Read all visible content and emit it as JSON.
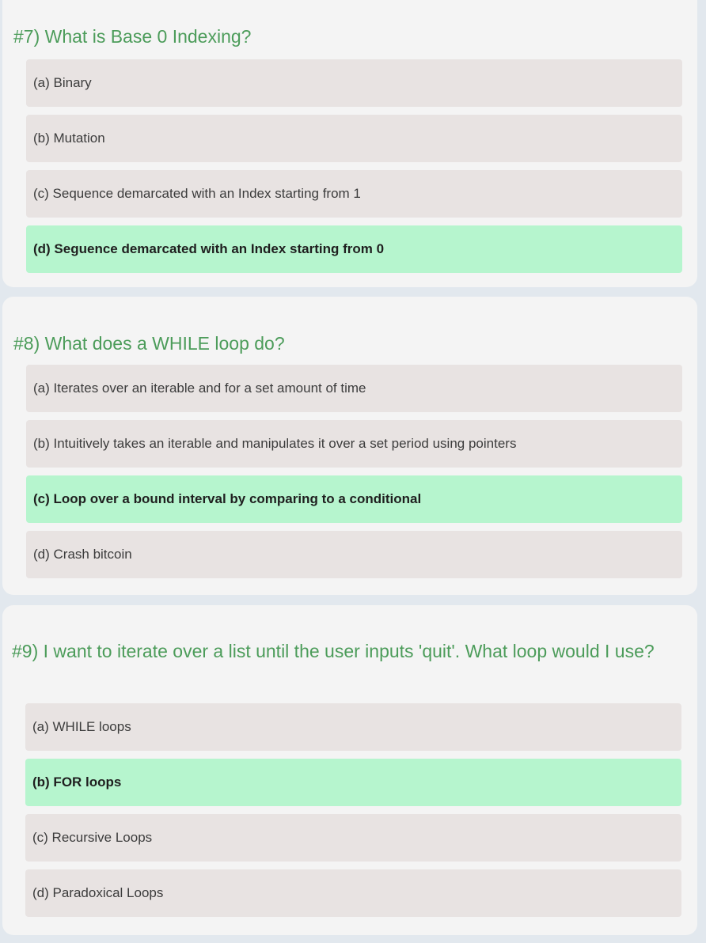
{
  "questions": [
    {
      "number": "#7)",
      "text": "What is Base 0 Indexing?",
      "options": [
        {
          "label": "(a) Binary",
          "correct": false
        },
        {
          "label": "(b) Mutation",
          "correct": false
        },
        {
          "label": "(c) Sequence demarcated with an Index starting from 1",
          "correct": false
        },
        {
          "label": "(d) Seguence demarcated with an Index starting from 0",
          "correct": true
        }
      ]
    },
    {
      "number": "#8)",
      "text": "What does a WHILE loop do?",
      "options": [
        {
          "label": "(a) Iterates over an iterable and for a set amount of time",
          "correct": false
        },
        {
          "label": "(b) Intuitively takes an iterable and manipulates it over a set period using pointers",
          "correct": false
        },
        {
          "label": "(c) Loop over a bound interval by comparing to a conditional",
          "correct": true
        },
        {
          "label": "(d) Crash bitcoin",
          "correct": false
        }
      ]
    },
    {
      "number": "#9)",
      "text": "I want to iterate over a list until the user inputs 'quit'. What loop would I use?",
      "options": [
        {
          "label": "(a) WHILE loops",
          "correct": false
        },
        {
          "label": "(b) FOR loops",
          "correct": true
        },
        {
          "label": "(c) Recursive Loops",
          "correct": false
        },
        {
          "label": "(d) Paradoxical Loops",
          "correct": false
        }
      ]
    }
  ],
  "colors": {
    "question_text": "#4c9c5a",
    "correct_option_bg": "#b6f5ce",
    "option_bg": "#e8e3e2",
    "card_bg": "#f4f4f4",
    "page_bg": "#e2e8ee"
  }
}
